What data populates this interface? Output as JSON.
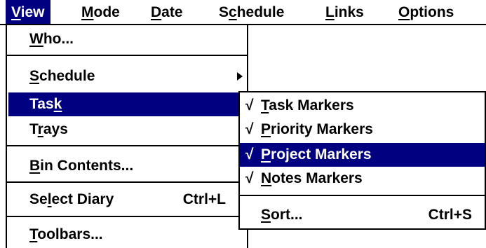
{
  "menubar": [
    {
      "pre": "",
      "key": "V",
      "post": "iew",
      "active": true
    },
    {
      "pre": "",
      "key": "M",
      "post": "ode",
      "active": false
    },
    {
      "pre": "",
      "key": "D",
      "post": "ate",
      "active": false
    },
    {
      "pre": "S",
      "key": "c",
      "post": "hedule",
      "active": false
    },
    {
      "pre": "",
      "key": "L",
      "post": "inks",
      "active": false
    },
    {
      "pre": "",
      "key": "O",
      "post": "ptions",
      "active": false
    }
  ],
  "view_menu": {
    "items": [
      {
        "pre": "",
        "key": "W",
        "post": "ho...",
        "shortcut": ""
      },
      {
        "pre": "",
        "key": "S",
        "post": "chedule",
        "shortcut": "",
        "submenu": true
      },
      {
        "pre": "Tas",
        "key": "k",
        "post": "",
        "shortcut": "",
        "active": true
      },
      {
        "pre": "T",
        "key": "r",
        "post": "ays",
        "shortcut": ""
      },
      {
        "pre": "",
        "key": "B",
        "post": "in Contents...",
        "shortcut": ""
      },
      {
        "pre": "Se",
        "key": "l",
        "post": "ect Diary",
        "shortcut": "Ctrl+L"
      },
      {
        "pre": "",
        "key": "T",
        "post": "oolbars...",
        "shortcut": ""
      }
    ]
  },
  "task_submenu": {
    "check_glyph": "√",
    "items": [
      {
        "pre": "",
        "key": "T",
        "post": "ask Markers",
        "checked": true,
        "shortcut": ""
      },
      {
        "pre": "",
        "key": "P",
        "post": "riority Markers",
        "checked": true,
        "shortcut": ""
      },
      {
        "pre": "",
        "key": "P",
        "post": "roject Markers",
        "checked": true,
        "shortcut": "",
        "active": true
      },
      {
        "pre": "",
        "key": "N",
        "post": "otes Markers",
        "checked": true,
        "shortcut": ""
      },
      {
        "pre": "",
        "key": "S",
        "post": "ort...",
        "checked": false,
        "shortcut": "Ctrl+S"
      }
    ]
  },
  "colors": {
    "highlight": "#000080",
    "highlight_text": "#ffffff",
    "background": "#ffffff",
    "text": "#000000"
  }
}
